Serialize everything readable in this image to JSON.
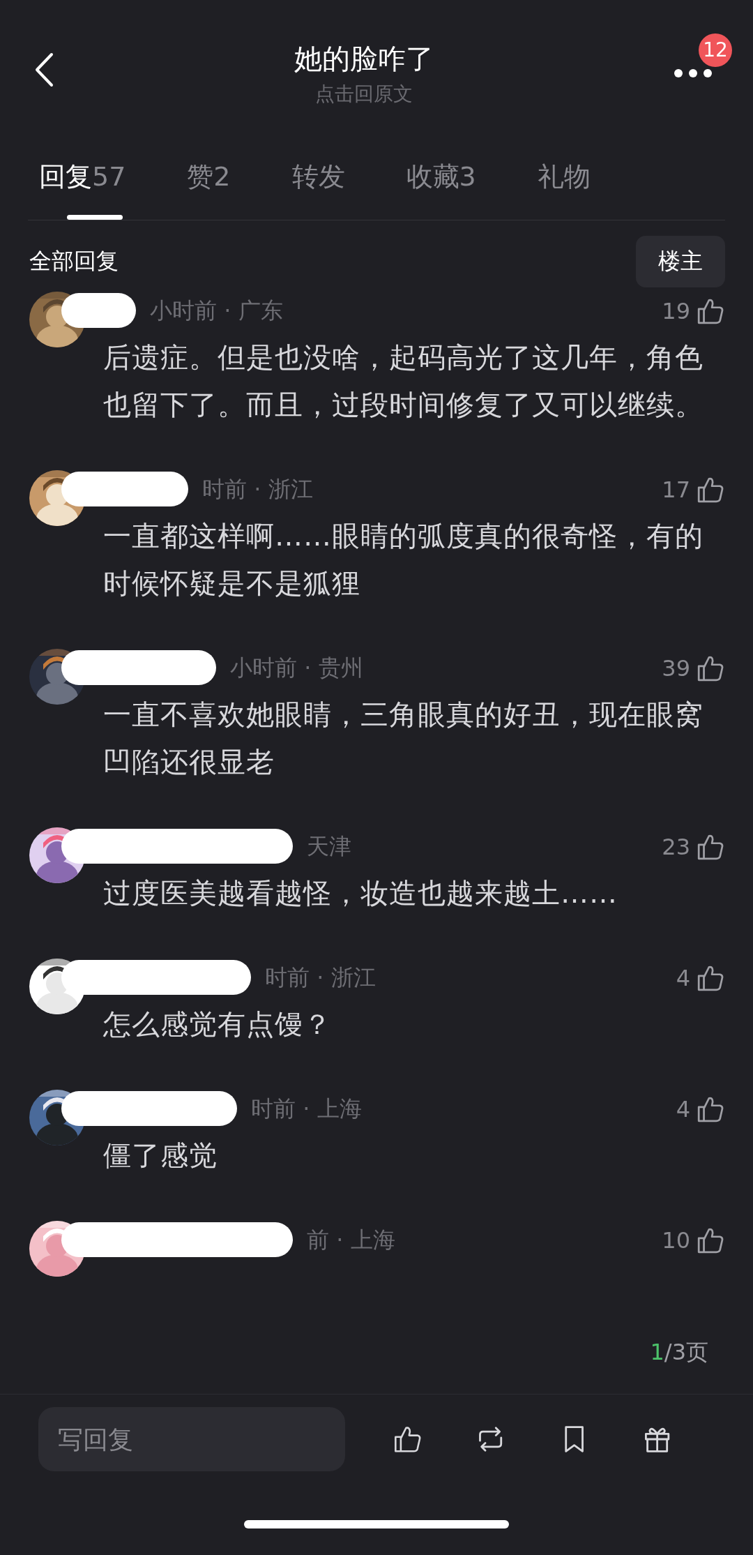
{
  "header": {
    "title": "她的脸咋了",
    "subtitle": "点击回原文",
    "badge": "12"
  },
  "tabs": [
    {
      "label": "回复",
      "count": "57",
      "selected": true
    },
    {
      "label": "赞",
      "count": "2",
      "selected": false
    },
    {
      "label": "转发",
      "selected": false
    },
    {
      "label": "收藏",
      "count": "3",
      "selected": false
    },
    {
      "label": "礼物",
      "selected": false
    }
  ],
  "section": {
    "title": "全部回复",
    "filter_button": "楼主"
  },
  "comments": [
    {
      "meta": "小时前 · 广东",
      "likes": "19",
      "text": "后遗症。但是也没啥，起码高光了这几年，角色也留下了。而且，过段时间修复了又可以继续。"
    },
    {
      "meta": "时前 · 浙江",
      "likes": "17",
      "text": "一直都这样啊……眼睛的弧度真的很奇怪，有的时候怀疑是不是狐狸"
    },
    {
      "meta": "小时前 · 贵州",
      "likes": "39",
      "text": "一直不喜欢她眼睛，三角眼真的好丑，现在眼窝凹陷还很显老"
    },
    {
      "meta": "天津",
      "likes": "23",
      "text": "过度医美越看越怪，妆造也越来越土……"
    },
    {
      "meta": "时前 · 浙江",
      "likes": "4",
      "text": "怎么感觉有点馒？"
    },
    {
      "meta": "时前 · 上海",
      "likes": "4",
      "text": "僵了感觉"
    },
    {
      "meta": "前 · 上海",
      "likes": "10"
    }
  ],
  "pager": {
    "current": "1",
    "total": "/3页"
  },
  "composer": {
    "placeholder": "写回复"
  }
}
